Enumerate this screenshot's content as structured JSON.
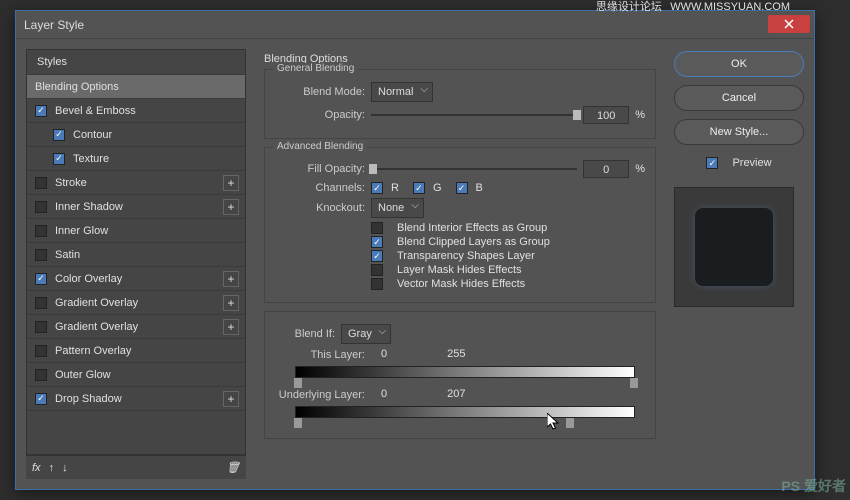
{
  "dialog": {
    "title": "Layer Style"
  },
  "watermarks": {
    "top_left": "思缘设计论坛",
    "top_right": "WWW.MISSYUAN.COM",
    "bottom_right": "PS 爱好者"
  },
  "styles": {
    "header": "Styles",
    "items": [
      {
        "label": "Blending Options",
        "checked": null,
        "selected": true,
        "plus": false,
        "indent": 0
      },
      {
        "label": "Bevel & Emboss",
        "checked": true,
        "selected": false,
        "plus": false,
        "indent": 0
      },
      {
        "label": "Contour",
        "checked": true,
        "selected": false,
        "plus": false,
        "indent": 1
      },
      {
        "label": "Texture",
        "checked": true,
        "selected": false,
        "plus": false,
        "indent": 1
      },
      {
        "label": "Stroke",
        "checked": false,
        "selected": false,
        "plus": true,
        "indent": 0
      },
      {
        "label": "Inner Shadow",
        "checked": false,
        "selected": false,
        "plus": true,
        "indent": 0
      },
      {
        "label": "Inner Glow",
        "checked": false,
        "selected": false,
        "plus": false,
        "indent": 0
      },
      {
        "label": "Satin",
        "checked": false,
        "selected": false,
        "plus": false,
        "indent": 0
      },
      {
        "label": "Color Overlay",
        "checked": true,
        "selected": false,
        "plus": true,
        "indent": 0
      },
      {
        "label": "Gradient Overlay",
        "checked": false,
        "selected": false,
        "plus": true,
        "indent": 0
      },
      {
        "label": "Gradient Overlay",
        "checked": false,
        "selected": false,
        "plus": true,
        "indent": 0
      },
      {
        "label": "Pattern Overlay",
        "checked": false,
        "selected": false,
        "plus": false,
        "indent": 0
      },
      {
        "label": "Outer Glow",
        "checked": false,
        "selected": false,
        "plus": false,
        "indent": 0
      },
      {
        "label": "Drop Shadow",
        "checked": true,
        "selected": false,
        "plus": true,
        "indent": 0
      }
    ],
    "footer": {
      "fx": "fx",
      "trash": "🗑"
    }
  },
  "options": {
    "title": "Blending Options",
    "general": {
      "legend": "General Blending",
      "blendMode": {
        "label": "Blend Mode:",
        "value": "Normal"
      },
      "opacity": {
        "label": "Opacity:",
        "value": "100",
        "unit": "%",
        "pos": 100
      }
    },
    "advanced": {
      "legend": "Advanced Blending",
      "fillOpacity": {
        "label": "Fill Opacity:",
        "value": "0",
        "unit": "%",
        "pos": 0
      },
      "channels": {
        "label": "Channels:",
        "r": "R",
        "g": "G",
        "b": "B",
        "rOn": true,
        "gOn": true,
        "bOn": true
      },
      "knockout": {
        "label": "Knockout:",
        "value": "None"
      },
      "opts": [
        {
          "label": "Blend Interior Effects as Group",
          "on": false
        },
        {
          "label": "Blend Clipped Layers as Group",
          "on": true
        },
        {
          "label": "Transparency Shapes Layer",
          "on": true
        },
        {
          "label": "Layer Mask Hides Effects",
          "on": false
        },
        {
          "label": "Vector Mask Hides Effects",
          "on": false
        }
      ]
    },
    "blendif": {
      "legend": "",
      "label": "Blend If:",
      "value": "Gray",
      "thisLayer": {
        "label": "This Layer:",
        "lo": "0",
        "hi": "255",
        "loPos": 0,
        "hiPos": 100
      },
      "underlying": {
        "label": "Underlying Layer:",
        "lo": "0",
        "hi": "207",
        "loPos": 0,
        "hiPos": 81
      }
    }
  },
  "buttons": {
    "ok": "OK",
    "cancel": "Cancel",
    "newStyle": "New Style..."
  },
  "preview": {
    "label": "Preview",
    "on": true
  }
}
